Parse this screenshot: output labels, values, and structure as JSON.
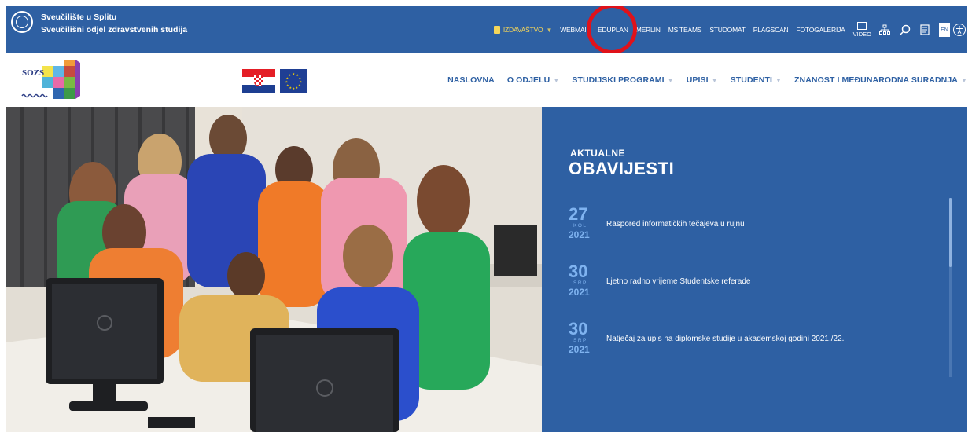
{
  "university": {
    "line1": "Sveučilište u Splitu",
    "line2": "Sveučilišni odjel zdravstvenih studija"
  },
  "top_nav": {
    "izdavastvo": "IZDAVAŠTVO",
    "webmail": "WEBMAIL",
    "eduplan": "EDUPLAN",
    "merlin": "MERLIN",
    "ms_teams": "MS TEAMS",
    "studomat": "STUDOMAT",
    "plagscan": "PLAGSCAN",
    "fotogalerija": "FOTOGALERIJA",
    "video": "VIDEO",
    "en": "EN"
  },
  "logo": {
    "text": "SOZS"
  },
  "main_nav": [
    {
      "label": "NASLOVNA"
    },
    {
      "label": "O ODJELU"
    },
    {
      "label": "STUDIJSKI PROGRAMI"
    },
    {
      "label": "UPISI"
    },
    {
      "label": "STUDENTI"
    },
    {
      "label": "ZNANOST I MEĐUNARODNA SURADNJA"
    }
  ],
  "news": {
    "kicker": "AKTUALNE",
    "title": "OBAVIJESTI",
    "items": [
      {
        "day": "27",
        "month": "KOL",
        "year": "2021",
        "text": "Raspored informatičkih tečajeva u rujnu"
      },
      {
        "day": "30",
        "month": "SRP",
        "year": "2021",
        "text": "Ljetno radno vrijeme Studentske referade"
      },
      {
        "day": "30",
        "month": "SRP",
        "year": "2021",
        "text": "Natječaj za upis na diplomske studije u akademskoj godini 2021./22."
      }
    ]
  },
  "colors": {
    "brand_blue": "#2e60a3",
    "highlight": "#e0121a",
    "date_accent": "#7fb3f0",
    "izdavastvo": "#f5d65a"
  }
}
